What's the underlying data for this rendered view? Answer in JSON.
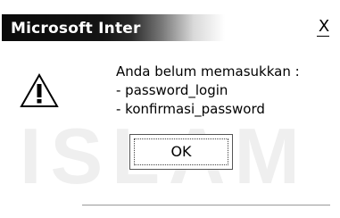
{
  "window": {
    "title": "Microsoft Inter"
  },
  "dialog": {
    "close_label": "X",
    "icon": "warning-triangle-icon",
    "message_lines": [
      "Anda belum memasukkan :",
      "- password_login",
      "- konfirmasi_password"
    ],
    "ok_label": "OK"
  },
  "watermark": {
    "text": "ISLAM"
  }
}
